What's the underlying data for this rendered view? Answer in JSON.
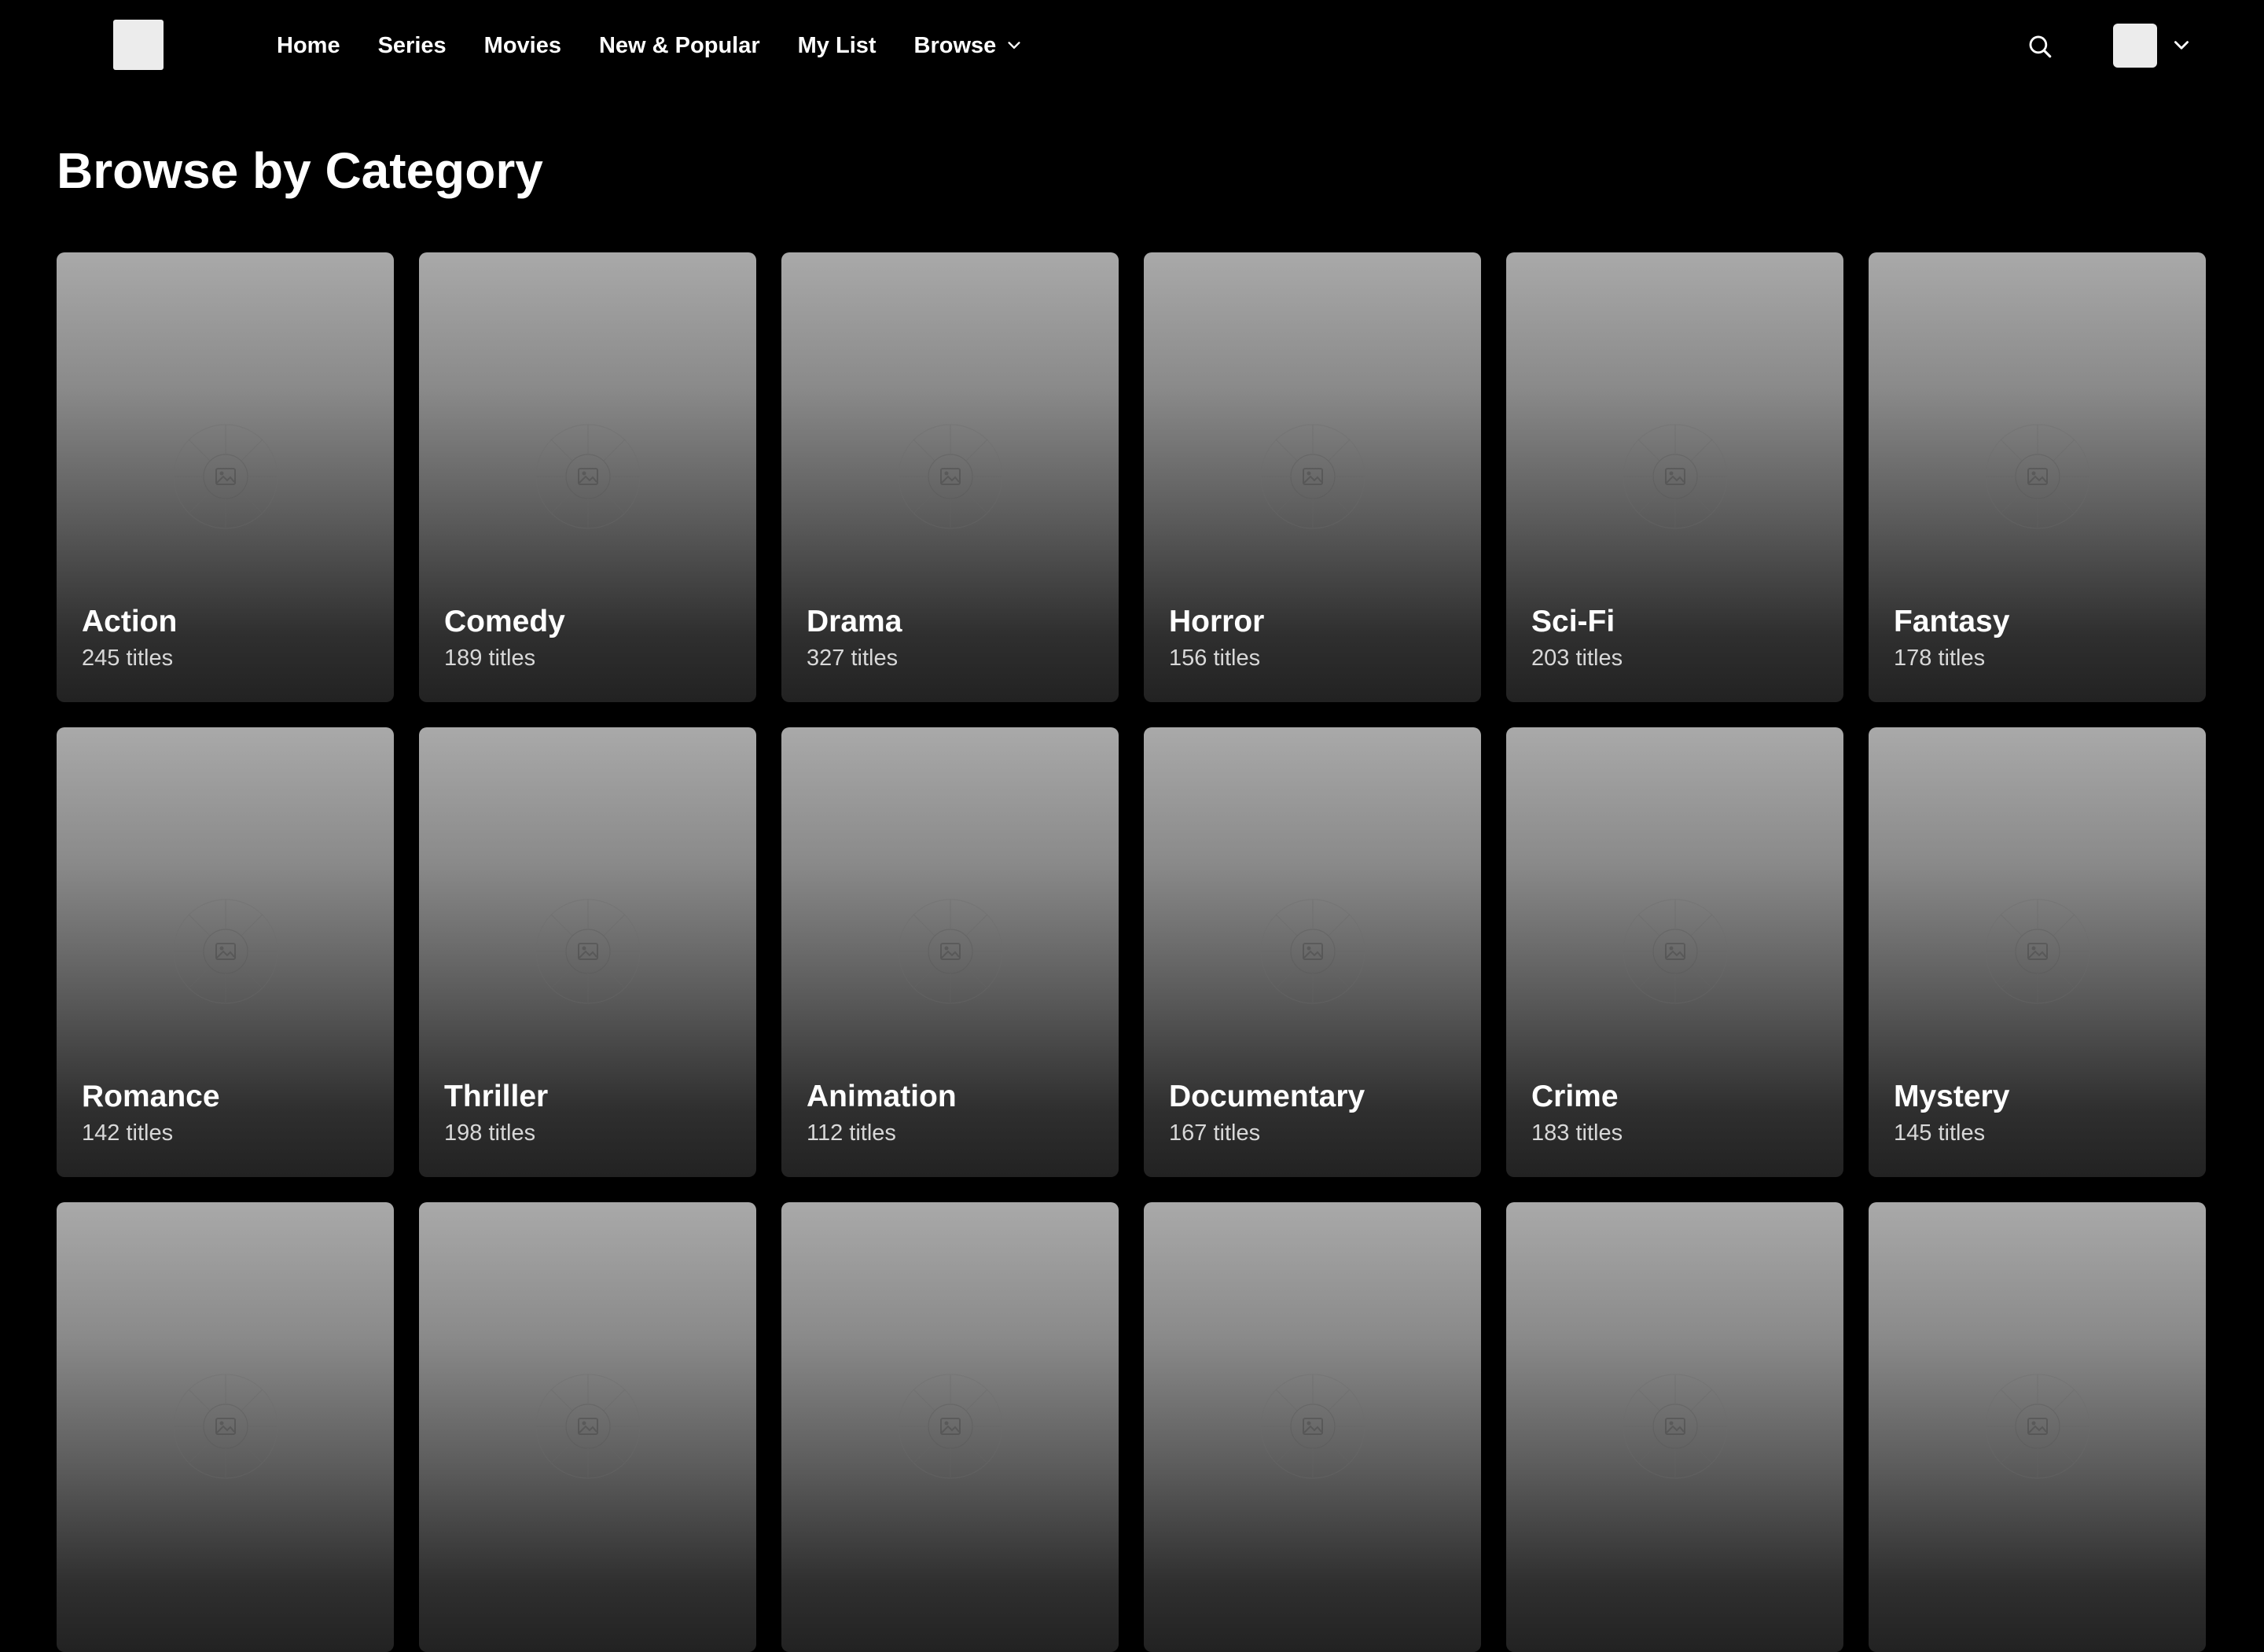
{
  "nav": {
    "links": [
      "Home",
      "Series",
      "Movies",
      "New & Popular",
      "My List",
      "Browse"
    ]
  },
  "page": {
    "title": "Browse by Category"
  },
  "categories": [
    {
      "name": "Action",
      "count": "245 titles"
    },
    {
      "name": "Comedy",
      "count": "189 titles"
    },
    {
      "name": "Drama",
      "count": "327 titles"
    },
    {
      "name": "Horror",
      "count": "156 titles"
    },
    {
      "name": "Sci-Fi",
      "count": "203 titles"
    },
    {
      "name": "Fantasy",
      "count": "178 titles"
    },
    {
      "name": "Romance",
      "count": "142 titles"
    },
    {
      "name": "Thriller",
      "count": "198 titles"
    },
    {
      "name": "Animation",
      "count": "112 titles"
    },
    {
      "name": "Documentary",
      "count": "167 titles"
    },
    {
      "name": "Crime",
      "count": "183 titles"
    },
    {
      "name": "Mystery",
      "count": "145 titles"
    },
    {
      "name": "",
      "count": ""
    },
    {
      "name": "",
      "count": ""
    },
    {
      "name": "",
      "count": ""
    },
    {
      "name": "",
      "count": ""
    },
    {
      "name": "",
      "count": ""
    },
    {
      "name": "",
      "count": ""
    }
  ],
  "icons": {
    "search": "search-icon",
    "chevron": "chevron-down-icon",
    "placeholder": "image-placeholder-icon"
  },
  "colors": {
    "background": "#000000",
    "text": "#ffffff",
    "card_top": "#a9a9a9",
    "card_bottom": "#222222"
  }
}
